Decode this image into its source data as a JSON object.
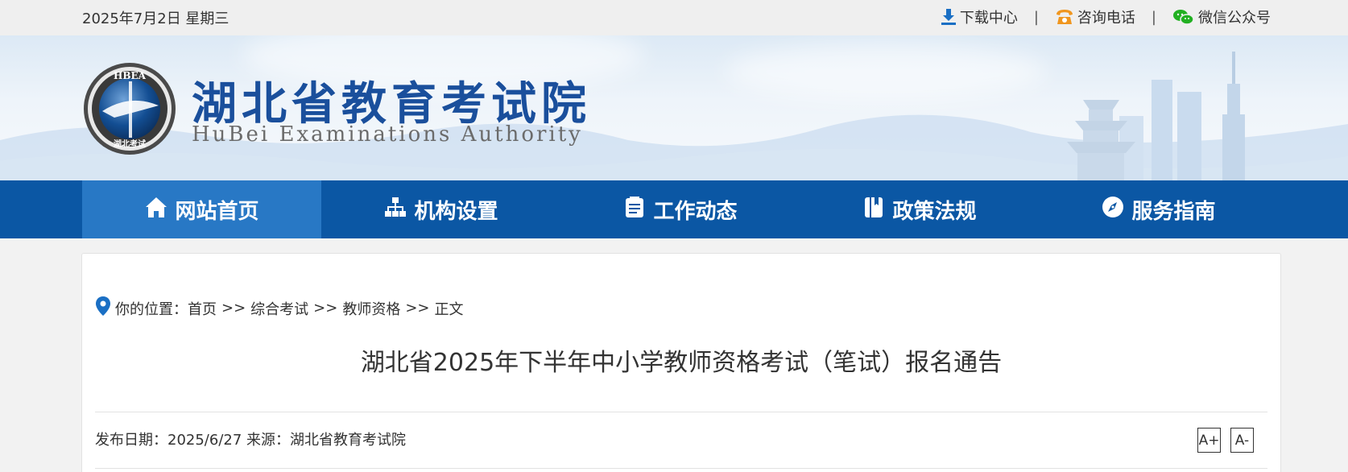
{
  "topbar": {
    "date": "2025年7月2日 星期三",
    "links": [
      {
        "label": "下载中心",
        "icon": "download-icon"
      },
      {
        "label": "咨询电话",
        "icon": "phone-icon"
      },
      {
        "label": "微信公众号",
        "icon": "wechat-icon"
      }
    ],
    "separator": "|"
  },
  "banner": {
    "title_cn": "湖北省教育考试院",
    "title_en": "HuBei Examinations Authority",
    "seal_top": "HBEA",
    "seal_bottom": "湖北考试"
  },
  "nav": {
    "items": [
      {
        "label": "网站首页",
        "icon": "home-icon",
        "active": true
      },
      {
        "label": "机构设置",
        "icon": "org-chart-icon",
        "active": false
      },
      {
        "label": "工作动态",
        "icon": "document-icon",
        "active": false
      },
      {
        "label": "政策法规",
        "icon": "book-icon",
        "active": false
      },
      {
        "label": "服务指南",
        "icon": "compass-icon",
        "active": false
      }
    ]
  },
  "breadcrumb": {
    "prefix": "你的位置：",
    "items": [
      "首页",
      "综合考试",
      "教师资格",
      "正文"
    ],
    "separator": ">>"
  },
  "article": {
    "title": "湖北省2025年下半年中小学教师资格考试（笔试）报名通告",
    "meta": "发布日期：2025/6/27 来源：湖北省教育考试院",
    "font_increase": "A+",
    "font_decrease": "A-"
  },
  "colors": {
    "nav_bg": "#0b57a4",
    "nav_active": "#2878c5",
    "brand_text": "#1a4f9c",
    "download_icon": "#1a6fc4",
    "phone_icon": "#f0961f",
    "wechat_icon": "#22b022"
  }
}
